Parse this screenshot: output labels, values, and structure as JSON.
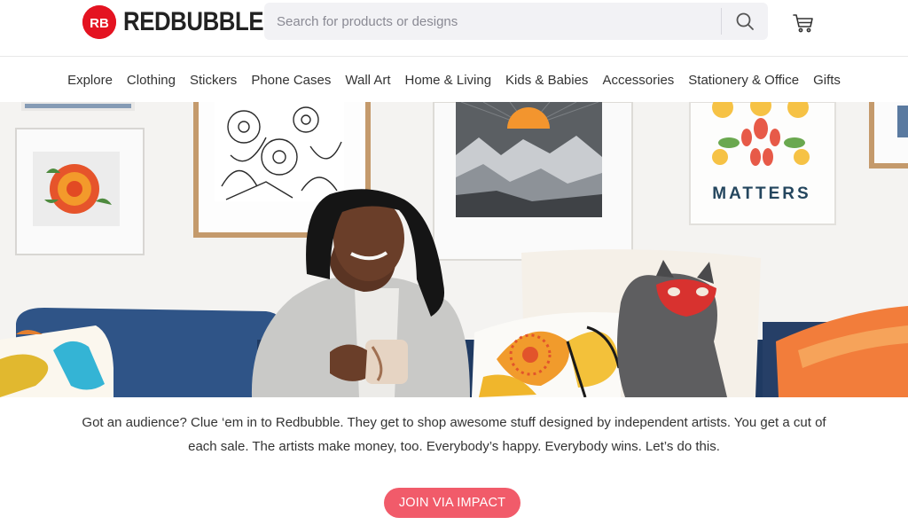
{
  "header": {
    "logo_text": "REDBUBBLE",
    "logo_mark": "RB",
    "search": {
      "placeholder": "Search for products or designs",
      "value": ""
    },
    "search_icon": "search-icon",
    "cart_icon": "cart-icon"
  },
  "nav": {
    "items": [
      "Explore",
      "Clothing",
      "Stickers",
      "Phone Cases",
      "Wall Art",
      "Home & Living",
      "Kids & Babies",
      "Accessories",
      "Stationery & Office",
      "Gifts"
    ]
  },
  "hero": {
    "poster_text": "MATTERS"
  },
  "caption": {
    "line1": "Got an audience? Clue ‘em in to Redbubble. They get to shop awesome stuff designed by independent artists. You get a cut of",
    "line2": "each sale. The artists make money, too. Everybody’s happy. Everybody wins. Let’s do this."
  },
  "cta": {
    "label": "JOIN VIA IMPACT"
  },
  "colors": {
    "brand": "#e41321",
    "cta": "#f15b6a",
    "search_bg": "#f2f2f5"
  }
}
